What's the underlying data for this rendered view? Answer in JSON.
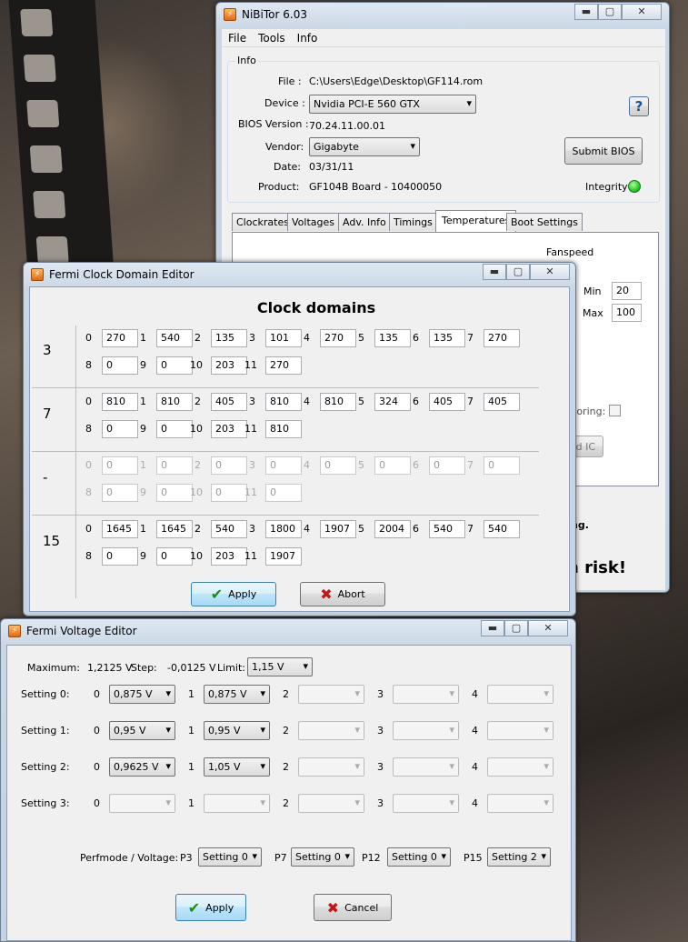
{
  "nibitor": {
    "title": "NiBiTor 6.03",
    "menu": [
      "File",
      "Tools",
      "Info"
    ],
    "info_group": "Info",
    "file_label": "File :",
    "file_value": "C:\\Users\\Edge\\Desktop\\GF114.rom",
    "device_label": "Device :",
    "device_value": "Nvidia PCI-E 560 GTX",
    "bios_label": "BIOS Version :",
    "bios_value": "70.24.11.00.01",
    "vendor_label": "Vendor:",
    "vendor_value": "Gigabyte",
    "date_label": "Date:",
    "date_value": "03/31/11",
    "product_label": "Product:",
    "product_value": "GF104B Board - 10400050",
    "help": "?",
    "submit": "Submit BIOS",
    "integrity_label": "Integrity :",
    "integrity_color": "#22cc22",
    "tabs": [
      "Clockrates",
      "Voltages",
      "Adv. Info",
      "Timings",
      "Temperatures",
      "Boot Settings"
    ],
    "active_tab": "Temperatures",
    "fanspeed": "Fanspeed",
    "min_label": "Min",
    "min_value": "20",
    "max_label": "Max",
    "max_value": "100",
    "partial_monitoring": "toring:",
    "partial_ic": "d IC",
    "partial_ng": "ng.",
    "partial_risk": "n risk!"
  },
  "clock": {
    "title": "Fermi Clock Domain Editor",
    "heading": "Clock domains",
    "rows": [
      {
        "label": "3",
        "enabled": true,
        "values": [
          "270",
          "540",
          "135",
          "101",
          "270",
          "135",
          "135",
          "270",
          "0",
          "0",
          "203",
          "270"
        ]
      },
      {
        "label": "7",
        "enabled": true,
        "values": [
          "810",
          "810",
          "405",
          "810",
          "810",
          "324",
          "405",
          "405",
          "0",
          "0",
          "203",
          "810"
        ]
      },
      {
        "label": "-",
        "enabled": false,
        "values": [
          "0",
          "0",
          "0",
          "0",
          "0",
          "0",
          "0",
          "0",
          "0",
          "0",
          "0",
          "0"
        ]
      },
      {
        "label": "15",
        "enabled": true,
        "values": [
          "1645",
          "1645",
          "540",
          "1800",
          "1907",
          "2004",
          "540",
          "540",
          "0",
          "0",
          "203",
          "1907"
        ]
      }
    ],
    "apply": "Apply",
    "abort": "Abort"
  },
  "voltage": {
    "title": "Fermi Voltage Editor",
    "maximum_label": "Maximum:",
    "maximum_value": "1,2125 V",
    "step_label": "Step:",
    "step_value": "-0,0125 V",
    "limit_label": "Limit:",
    "limit_value": "1,15 V",
    "settings": [
      {
        "label": "Setting 0:",
        "values": [
          "0,875 V",
          "0,875 V",
          "",
          "",
          ""
        ]
      },
      {
        "label": "Setting 1:",
        "values": [
          "0,95 V",
          "0,95 V",
          "",
          "",
          ""
        ]
      },
      {
        "label": "Setting 2:",
        "values": [
          "0,9625 V",
          "1,05 V",
          "",
          "",
          ""
        ]
      },
      {
        "label": "Setting 3:",
        "values": [
          "",
          "",
          "",
          "",
          ""
        ]
      }
    ],
    "perf_label": "Perfmode / Voltage:",
    "perf": [
      {
        "label": "P3",
        "value": "Setting 0"
      },
      {
        "label": "P7",
        "value": "Setting 0"
      },
      {
        "label": "P12",
        "value": "Setting 0"
      },
      {
        "label": "P15",
        "value": "Setting 2"
      }
    ],
    "apply": "Apply",
    "cancel": "Cancel"
  },
  "caption_buttons": {
    "minimize": "▬",
    "maximize": "▢",
    "close": "✕"
  }
}
